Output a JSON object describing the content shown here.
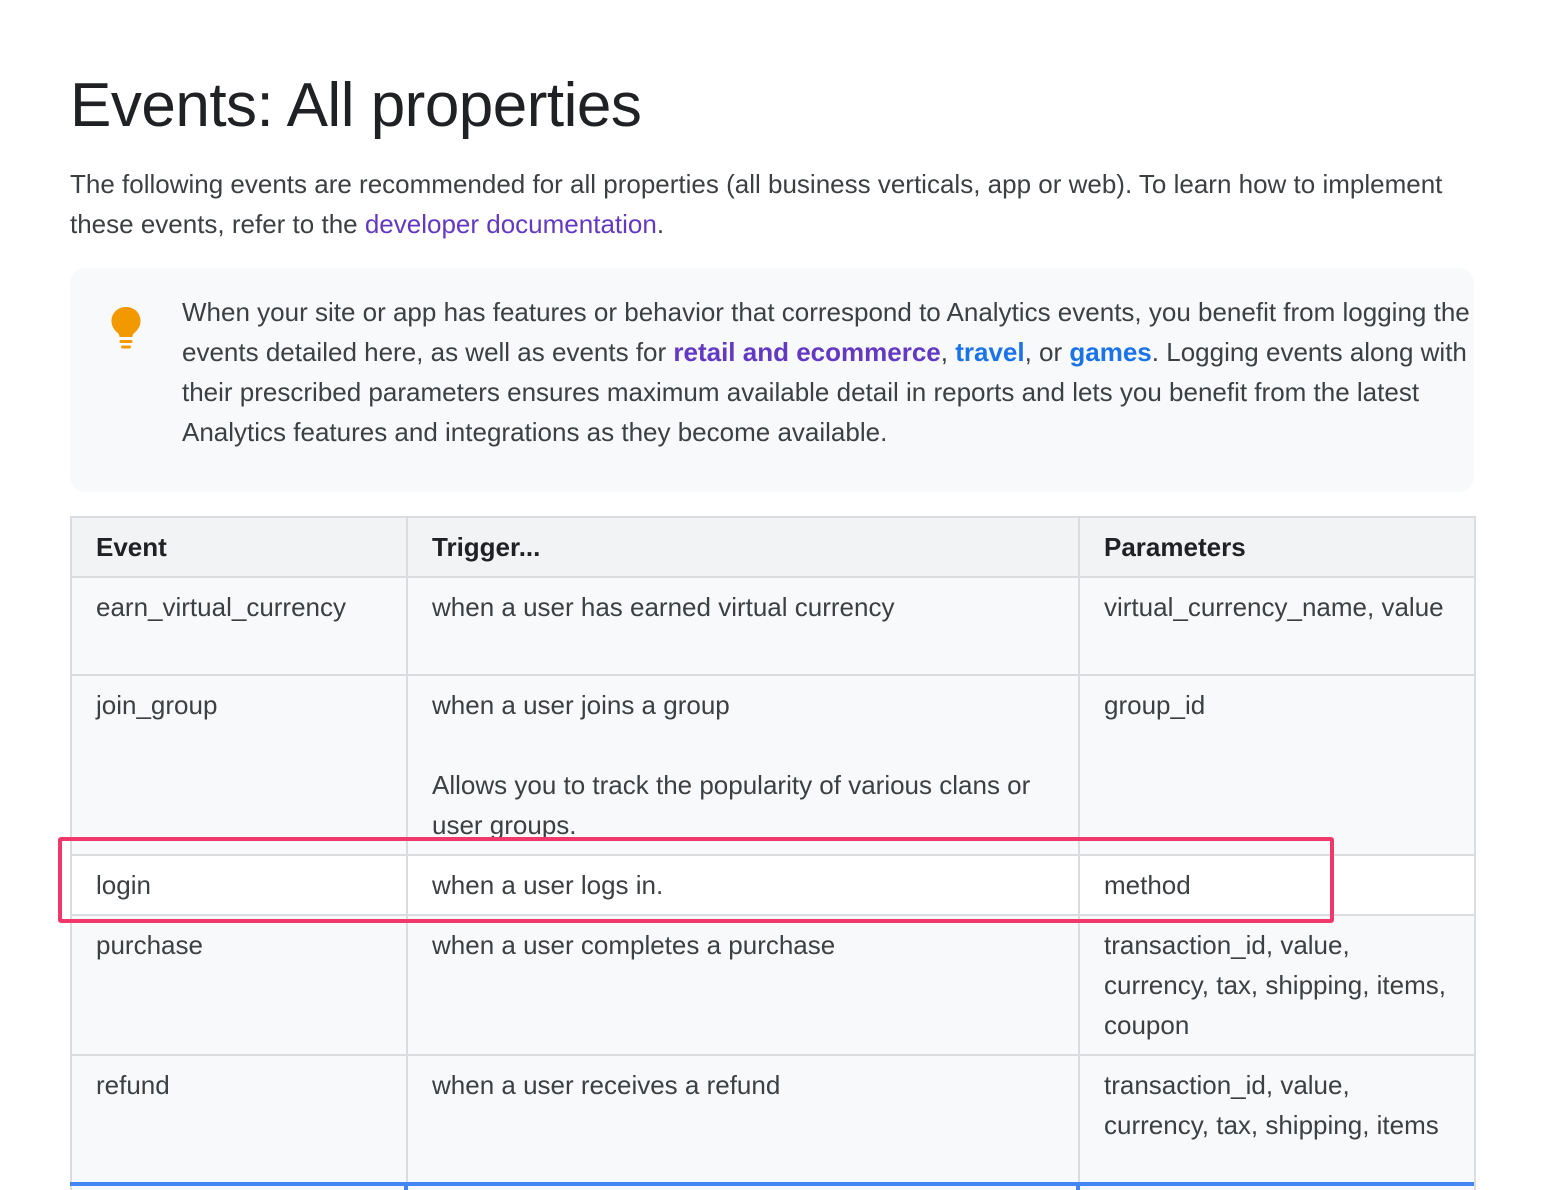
{
  "page": {
    "title": "Events: All properties",
    "intro_before_link": "The following events are recommended for all properties (all business verticals, app or web). To learn how to implement these events, refer to the ",
    "intro_link": "developer documentation",
    "intro_after_link": "."
  },
  "tip": {
    "icon": "lightbulb-icon",
    "text_1": "When your site or app has features or behavior that correspond to Analytics events, you benefit from logging the events detailed here, as well as events for ",
    "link_retail": "retail and ecommerce",
    "sep_1": ", ",
    "link_travel": "travel",
    "sep_2": ", or ",
    "link_games": "games",
    "text_2": ". Logging events along with their prescribed parameters ensures maximum available detail in reports and lets you benefit from the latest Analytics features and integrations as they become available."
  },
  "table": {
    "headers": [
      "Event",
      "Trigger...",
      "Parameters"
    ],
    "rows": [
      {
        "event": "earn_virtual_currency",
        "trigger": "when a user has earned virtual currency",
        "trigger_note": "",
        "parameters": "virtual_currency_name, value"
      },
      {
        "event": "join_group",
        "trigger": "when a user joins a group",
        "trigger_note": "Allows you to track the popularity of various clans or user groups.",
        "parameters": "group_id"
      },
      {
        "event": "login",
        "trigger": "when a user logs in.",
        "trigger_note": "",
        "parameters": "method"
      },
      {
        "event": "purchase",
        "trigger": "when a user completes a purchase",
        "trigger_note": "",
        "parameters": "transaction_id, value, currency, tax, shipping, items, coupon"
      },
      {
        "event": "refund",
        "trigger": "when a user receives a refund",
        "trigger_note": "",
        "parameters": "transaction_id, value, currency, tax, shipping, items"
      }
    ]
  },
  "colors": {
    "link_purple": "#6339c4",
    "link_blue": "#1a73e8",
    "tip_icon": "#f29900",
    "highlight_box": "#f0386b",
    "table_border": "#dadce0"
  }
}
